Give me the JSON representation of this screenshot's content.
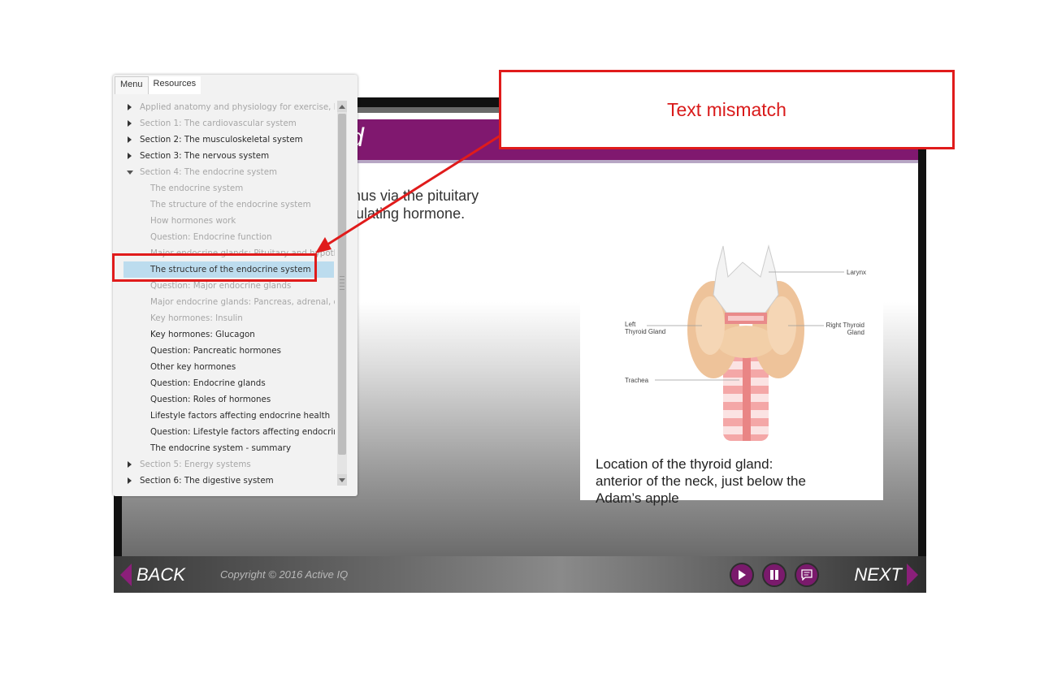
{
  "slide": {
    "title_fragment": "d",
    "body_lines": [
      "alamus via the pituitary",
      "stimulating hormone."
    ],
    "image_labels": {
      "larynx": "Larynx",
      "left_thyroid_1": "Left",
      "left_thyroid_2": "Thyroid Gland",
      "right_thyroid_1": "Right Thyroid",
      "right_thyroid_2": "Gland",
      "trachea": "Trachea"
    },
    "caption_lines": [
      "Location of the thyroid gland:",
      "anterior of the neck, just below the",
      "Adam’s apple"
    ]
  },
  "controls": {
    "back_label": "BACK",
    "next_label": "NEXT",
    "copyright": "Copyright © 2016 Active IQ",
    "play_icon": "play-icon",
    "pause_icon": "pause-icon",
    "captions_icon": "captions-icon"
  },
  "menu": {
    "tabs": [
      "Menu",
      "Resources"
    ],
    "items": [
      {
        "label": "Applied anatomy and physiology for exercise, h...",
        "level": "section",
        "state": "dim",
        "caret": "right"
      },
      {
        "label": "Section 1: The cardiovascular system",
        "level": "section",
        "state": "dim",
        "caret": "right"
      },
      {
        "label": "Section 2: The musculoskeletal system",
        "level": "section",
        "state": "dark",
        "caret": "right"
      },
      {
        "label": "Section 3: The nervous system",
        "level": "section",
        "state": "dark",
        "caret": "right"
      },
      {
        "label": "Section 4: The endocrine system",
        "level": "section",
        "state": "dim",
        "caret": "down"
      },
      {
        "label": "The endocrine system",
        "level": "sub",
        "state": "dim"
      },
      {
        "label": "The structure of the endocrine system",
        "level": "sub",
        "state": "dim"
      },
      {
        "label": "How hormones work",
        "level": "sub",
        "state": "dim"
      },
      {
        "label": "Question: Endocrine function",
        "level": "sub",
        "state": "dim"
      },
      {
        "label": "Major endocrine glands: Pituitary and hypoth...",
        "level": "sub",
        "state": "dim"
      },
      {
        "label": "The structure of the endocrine system",
        "level": "sub",
        "state": "selected"
      },
      {
        "label": "Question: Major endocrine glands",
        "level": "sub",
        "state": "dim"
      },
      {
        "label": "Major endocrine glands: Pancreas, adrenal, ov...",
        "level": "sub",
        "state": "dim"
      },
      {
        "label": "Key hormones: Insulin",
        "level": "sub",
        "state": "dim"
      },
      {
        "label": "Key hormones: Glucagon",
        "level": "sub",
        "state": "dark"
      },
      {
        "label": "Question: Pancreatic hormones",
        "level": "sub",
        "state": "dark"
      },
      {
        "label": "Other key hormones",
        "level": "sub",
        "state": "dark"
      },
      {
        "label": "Question: Endocrine glands",
        "level": "sub",
        "state": "dark"
      },
      {
        "label": "Question: Roles of hormones",
        "level": "sub",
        "state": "dark"
      },
      {
        "label": "Lifestyle factors affecting endocrine health",
        "level": "sub",
        "state": "dark"
      },
      {
        "label": "Question: Lifestyle factors affecting endocrin...",
        "level": "sub",
        "state": "dark"
      },
      {
        "label": "The endocrine system - summary",
        "level": "sub",
        "state": "dark"
      },
      {
        "label": "Section 5: Energy systems",
        "level": "section",
        "state": "dim",
        "caret": "right"
      },
      {
        "label": "Section 6: The digestive system",
        "level": "section",
        "state": "dark",
        "caret": "right"
      }
    ]
  },
  "annotation": {
    "label": "Text mismatch",
    "color": "#e01b1b"
  },
  "colors": {
    "brand_purple": "#80186f",
    "selection_blue": "#bcdcee"
  }
}
